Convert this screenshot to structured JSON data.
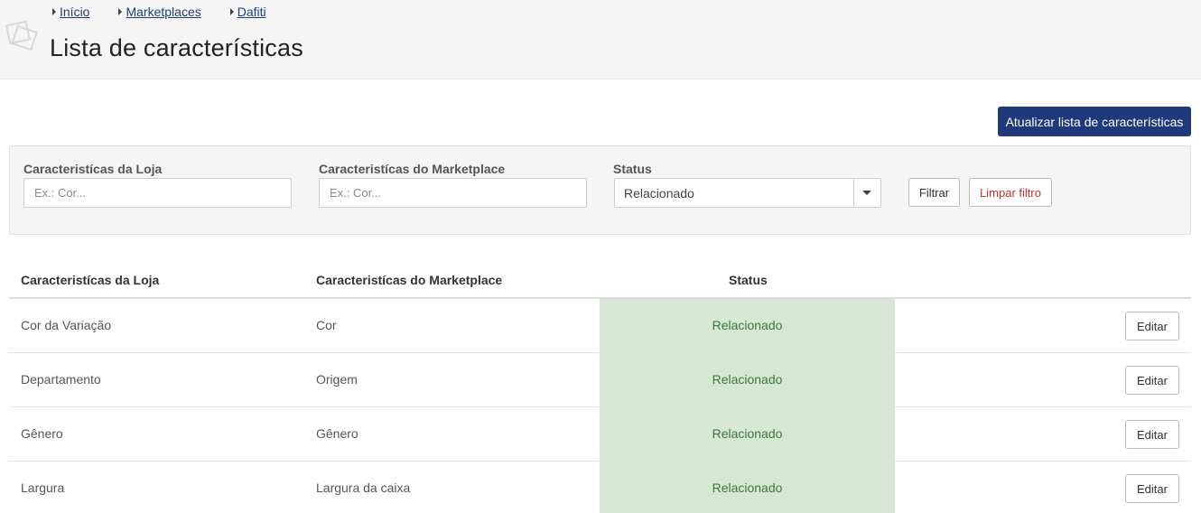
{
  "breadcrumb": [
    {
      "label": "Início"
    },
    {
      "label": "Marketplaces"
    },
    {
      "label": "Dafiti"
    }
  ],
  "page_title": "Lista de características",
  "update_button": "Atualizar lista de características",
  "filters": {
    "store_label": "Caracteristícas da Loja",
    "store_placeholder": "Ex.: Cor...",
    "marketplace_label": "Caracteristícas do Marketplace",
    "marketplace_placeholder": "Ex.: Cor...",
    "status_label": "Status",
    "status_value": "Relacionado",
    "filter_button": "Filtrar",
    "clear_button": "Limpar filtro"
  },
  "table": {
    "headers": [
      "Caracteristícas da Loja",
      "Caracteristícas do Marketplace",
      "Status"
    ],
    "rows": [
      {
        "store": "Cor da Variação",
        "marketplace": "Cor",
        "status": "Relacionado",
        "action": "Editar"
      },
      {
        "store": "Departamento",
        "marketplace": "Origem",
        "status": "Relacionado",
        "action": "Editar"
      },
      {
        "store": "Gênero",
        "marketplace": "Gênero",
        "status": "Relacionado",
        "action": "Editar"
      },
      {
        "store": "Largura",
        "marketplace": "Largura da caixa",
        "status": "Relacionado",
        "action": "Editar"
      }
    ]
  },
  "colors": {
    "primary": "#1f3a7a",
    "status_bg": "#d6e8d4",
    "status_text": "#3c763d",
    "danger": "#c9302c"
  }
}
